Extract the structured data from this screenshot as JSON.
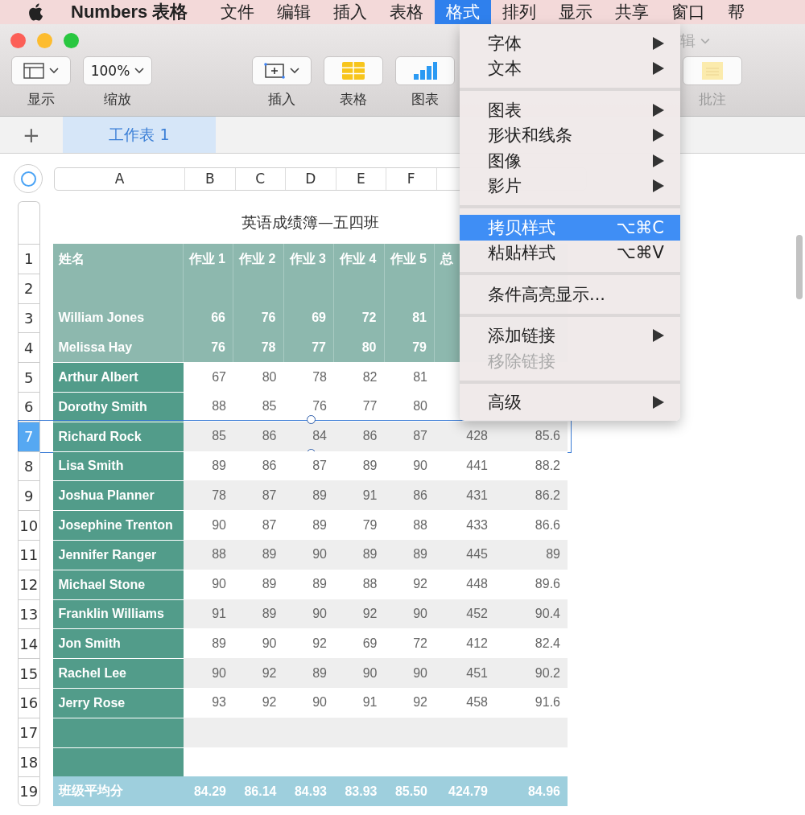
{
  "menubar": {
    "app_name": "Numbers 表格",
    "items": [
      {
        "label": "文件",
        "selected": false
      },
      {
        "label": "编辑",
        "selected": false
      },
      {
        "label": "插入",
        "selected": false
      },
      {
        "label": "表格",
        "selected": false
      },
      {
        "label": "格式",
        "selected": true
      },
      {
        "label": "排列",
        "selected": false
      },
      {
        "label": "显示",
        "selected": false
      },
      {
        "label": "共享",
        "selected": false
      },
      {
        "label": "窗口",
        "selected": false
      },
      {
        "label": "帮",
        "selected": false
      }
    ]
  },
  "window": {
    "title_partial": "辑",
    "toolbar": [
      {
        "kind": "view",
        "label": "显示"
      },
      {
        "kind": "zoom",
        "label": "缩放",
        "value": "100%"
      },
      {
        "kind": "insert",
        "label": "插入"
      },
      {
        "kind": "table",
        "label": "表格"
      },
      {
        "kind": "chart",
        "label": "图表"
      },
      {
        "kind": "comment",
        "label": "批注",
        "disabled": true
      }
    ]
  },
  "sheets": {
    "add": "+",
    "tabs": [
      {
        "label": "工作表 1",
        "selected": true
      }
    ]
  },
  "column_headers": [
    "A",
    "B",
    "C",
    "D",
    "E",
    "F"
  ],
  "table": {
    "title": "英语成绩簿—五四班",
    "rows": [
      {
        "number": "1",
        "kind": "header",
        "selected": false,
        "cells": [
          "姓名",
          "作业 1",
          "作业 2",
          "作业 3",
          "作业 4",
          "作业 5",
          "总"
        ]
      },
      {
        "number": "2",
        "kind": "header",
        "selected": false,
        "cells": []
      },
      {
        "number": "3",
        "kind": "header",
        "selected": false,
        "cells": [
          "William Jones",
          "66",
          "76",
          "69",
          "72",
          "81"
        ]
      },
      {
        "number": "4",
        "kind": "header",
        "selected": false,
        "cells": [
          "Melissa Hay",
          "76",
          "78",
          "77",
          "80",
          "79"
        ]
      },
      {
        "number": "5",
        "kind": "body",
        "selected": false,
        "shaded": false,
        "cells": [
          "Arthur Albert",
          "67",
          "80",
          "78",
          "82",
          "81"
        ]
      },
      {
        "number": "6",
        "kind": "body",
        "selected": false,
        "shaded": false,
        "cells": [
          "Dorothy Smith",
          "88",
          "85",
          "76",
          "77",
          "80"
        ]
      },
      {
        "number": "7",
        "kind": "body",
        "selected": true,
        "shaded": true,
        "cells": [
          "Richard Rock",
          "85",
          "86",
          "84",
          "86",
          "87",
          "428",
          "85.6"
        ]
      },
      {
        "number": "8",
        "kind": "body",
        "selected": false,
        "shaded": false,
        "cells": [
          "Lisa Smith",
          "89",
          "86",
          "87",
          "89",
          "90",
          "441",
          "88.2"
        ]
      },
      {
        "number": "9",
        "kind": "body",
        "selected": false,
        "shaded": true,
        "cells": [
          "Joshua Planner",
          "78",
          "87",
          "89",
          "91",
          "86",
          "431",
          "86.2"
        ]
      },
      {
        "number": "10",
        "kind": "body",
        "selected": false,
        "shaded": false,
        "cells": [
          "Josephine Trenton",
          "90",
          "87",
          "89",
          "79",
          "88",
          "433",
          "86.6"
        ]
      },
      {
        "number": "11",
        "kind": "body",
        "selected": false,
        "shaded": true,
        "cells": [
          "Jennifer Ranger",
          "88",
          "89",
          "90",
          "89",
          "89",
          "445",
          "89"
        ]
      },
      {
        "number": "12",
        "kind": "body",
        "selected": false,
        "shaded": false,
        "cells": [
          "Michael Stone",
          "90",
          "89",
          "89",
          "88",
          "92",
          "448",
          "89.6"
        ]
      },
      {
        "number": "13",
        "kind": "body",
        "selected": false,
        "shaded": true,
        "cells": [
          "Franklin Williams",
          "91",
          "89",
          "90",
          "92",
          "90",
          "452",
          "90.4"
        ]
      },
      {
        "number": "14",
        "kind": "body",
        "selected": false,
        "shaded": false,
        "cells": [
          "Jon Smith",
          "89",
          "90",
          "92",
          "69",
          "72",
          "412",
          "82.4"
        ]
      },
      {
        "number": "15",
        "kind": "body",
        "selected": false,
        "shaded": true,
        "cells": [
          "Rachel Lee",
          "90",
          "92",
          "89",
          "90",
          "90",
          "451",
          "90.2"
        ]
      },
      {
        "number": "16",
        "kind": "body",
        "selected": false,
        "shaded": false,
        "cells": [
          "Jerry Rose",
          "93",
          "92",
          "90",
          "91",
          "92",
          "458",
          "91.6"
        ]
      },
      {
        "number": "17",
        "kind": "body",
        "selected": false,
        "shaded": true,
        "cells": []
      },
      {
        "number": "18",
        "kind": "body",
        "selected": false,
        "shaded": false,
        "cells": []
      },
      {
        "number": "19",
        "kind": "footer",
        "selected": false,
        "cells": [
          "班级平均分",
          "84.29",
          "86.14",
          "84.93",
          "83.93",
          "85.50",
          "424.79",
          "84.96"
        ]
      }
    ]
  },
  "format_menu": {
    "items": [
      {
        "kind": "submenu",
        "label": "字体",
        "selected": false,
        "disabled": false
      },
      {
        "kind": "submenu",
        "label": "文本",
        "selected": false,
        "disabled": false
      },
      {
        "kind": "separator"
      },
      {
        "kind": "submenu",
        "label": "图表",
        "selected": false,
        "disabled": false
      },
      {
        "kind": "submenu",
        "label": "形状和线条",
        "selected": false,
        "disabled": false
      },
      {
        "kind": "submenu",
        "label": "图像",
        "selected": false,
        "disabled": false
      },
      {
        "kind": "submenu",
        "label": "影片",
        "selected": false,
        "disabled": false
      },
      {
        "kind": "separator"
      },
      {
        "kind": "shortcut",
        "label": "拷贝样式",
        "shortcut": "⌥⌘C",
        "selected": true,
        "disabled": false
      },
      {
        "kind": "shortcut",
        "label": "粘贴样式",
        "shortcut": "⌥⌘V",
        "selected": false,
        "disabled": false
      },
      {
        "kind": "separator"
      },
      {
        "kind": "plain",
        "label": "条件高亮显示...",
        "selected": false,
        "disabled": false
      },
      {
        "kind": "separator"
      },
      {
        "kind": "submenu",
        "label": "添加链接",
        "selected": false,
        "disabled": false
      },
      {
        "kind": "plain",
        "label": "移除链接",
        "selected": false,
        "disabled": true
      },
      {
        "kind": "separator"
      },
      {
        "kind": "submenu",
        "label": "高级",
        "selected": false,
        "disabled": false
      }
    ]
  }
}
